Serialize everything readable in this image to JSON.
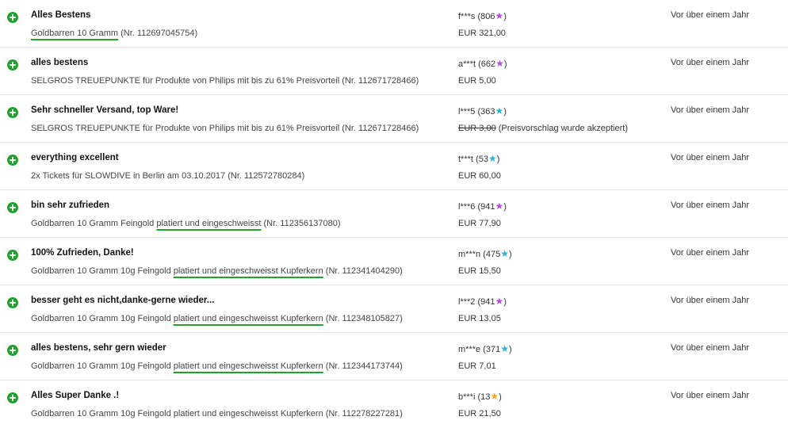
{
  "colors": {
    "positive_green": "#1fa32c",
    "underline_green": "#1fa32c",
    "star_purple": "#b54ed6",
    "star_turquoise": "#2bb0d8",
    "star_yellow": "#f5a623"
  },
  "icons": {
    "rating": "plus-circle-icon",
    "score": "star-icon"
  },
  "rows": [
    {
      "comment": "Alles Bestens",
      "item_pre": "",
      "item_hl": "Goldbarren 10 Gramm",
      "item_post": " (Nr. 112697045754)",
      "user": "f***s",
      "score": "806",
      "star_color": "#b54ed6",
      "price": "EUR 321,00",
      "price_note": "",
      "date": "Vor über einem Jahr"
    },
    {
      "comment": "alles bestens",
      "item_pre": "SELGROS TREUEPUNKTE für Produkte von Philips mit bis zu 61% Preisvorteil (Nr. 112671728466)",
      "item_hl": "",
      "item_post": "",
      "user": "a***t",
      "score": "662",
      "star_color": "#b54ed6",
      "price": "EUR 5,00",
      "price_note": "",
      "date": "Vor über einem Jahr"
    },
    {
      "comment": "Sehr schneller Versand, top Ware!",
      "item_pre": "SELGROS TREUEPUNKTE für Produkte von Philips mit bis zu 61% Preisvorteil (Nr. 112671728466)",
      "item_hl": "",
      "item_post": "",
      "user": "l***5",
      "score": "363",
      "star_color": "#2bb0d8",
      "price": "EUR 3,00",
      "price_note": " (Preisvorschlag wurde akzeptiert)",
      "date": "Vor über einem Jahr"
    },
    {
      "comment": "everything excellent",
      "item_pre": "2x Tickets für SLOWDIVE in Berlin am 03.10.2017 (Nr. 112572780284)",
      "item_hl": "",
      "item_post": "",
      "user": "t***t",
      "score": "53",
      "star_color": "#2bb0d8",
      "price": "EUR 60,00",
      "price_note": "",
      "date": "Vor über einem Jahr"
    },
    {
      "comment": "bin sehr zufrieden",
      "item_pre": "Goldbarren 10 Gramm Feingold ",
      "item_hl": "platiert und eingeschweisst",
      "item_post": " (Nr. 112356137080)",
      "user": "l***6",
      "score": "941",
      "star_color": "#b54ed6",
      "price": "EUR 77,90",
      "price_note": "",
      "date": "Vor über einem Jahr"
    },
    {
      "comment": "100% Zufrieden, Danke!",
      "item_pre": "Goldbarren 10 Gramm 10g Feingold ",
      "item_hl": "platiert und eingeschweisst Kupferkern",
      "item_post": " (Nr. 112341404290)",
      "user": "m***n",
      "score": "475",
      "star_color": "#2bb0d8",
      "price": "EUR 15,50",
      "price_note": "",
      "date": "Vor über einem Jahr"
    },
    {
      "comment": "besser geht es nicht,danke-gerne wieder...",
      "item_pre": "Goldbarren 10 Gramm 10g Feingold ",
      "item_hl": "platiert und eingeschweisst Kupferkern",
      "item_post": " (Nr. 112348105827)",
      "user": "l***2",
      "score": "941",
      "star_color": "#b54ed6",
      "price": "EUR 13,05",
      "price_note": "",
      "date": "Vor über einem Jahr"
    },
    {
      "comment": "alles bestens, sehr gern wieder",
      "item_pre": "Goldbarren 10 Gramm 10g Feingold ",
      "item_hl": "platiert und eingeschweisst Kupferkern",
      "item_post": " (Nr. 112344173744)",
      "user": "m***e",
      "score": "371",
      "star_color": "#2bb0d8",
      "price": "EUR 7,01",
      "price_note": "",
      "date": "Vor über einem Jahr"
    },
    {
      "comment": "Alles Super Danke .!",
      "item_pre": "Goldbarren 10 Gramm 10g Feingold platiert und eingeschweisst Kupferkern (Nr. 112278227281)",
      "item_hl": "",
      "item_post": "",
      "user": "b***i",
      "score": "13",
      "star_color": "#f5a623",
      "price": "EUR 21,50",
      "price_note": "",
      "date": "Vor über einem Jahr"
    }
  ]
}
